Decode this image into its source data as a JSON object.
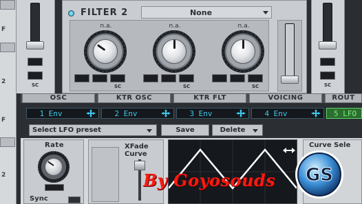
{
  "left_rail": {
    "labels": [
      "F",
      "2",
      "F",
      "2"
    ]
  },
  "left_col": {
    "sc_label": "SC"
  },
  "filter": {
    "title": "FILTER 2",
    "type": "None",
    "knobs": [
      {
        "label": "n.a.",
        "sc": "SC"
      },
      {
        "label": "n.a.",
        "sc": "SC"
      },
      {
        "label": "n.a.",
        "sc": "SC"
      }
    ]
  },
  "right_col": {
    "sc_label": "SC"
  },
  "section_tabs": [
    "OSC",
    "KTR OSC",
    "KTR FLT",
    "VOICING",
    "ROUT"
  ],
  "env_slots": [
    "1 Env",
    "2 Env",
    "3 Env",
    "4 Env"
  ],
  "lfo_slot": "5 LFO",
  "preset_bar": {
    "select_label": "Select LFO preset",
    "save_label": "Save",
    "delete_label": "Delete"
  },
  "lfo": {
    "rate_label": "Rate",
    "sync_label": "Sync",
    "xfade_label_1": "XFade",
    "xfade_label_2": "Curve",
    "curve_select_label": "Curve Sele"
  },
  "watermark": {
    "text": "By Goyosouds",
    "logo_text": "GS"
  },
  "colors": {
    "accent": "#3ec8ee",
    "lfo": "#5fd36a",
    "watermark": "#ff1a10"
  }
}
